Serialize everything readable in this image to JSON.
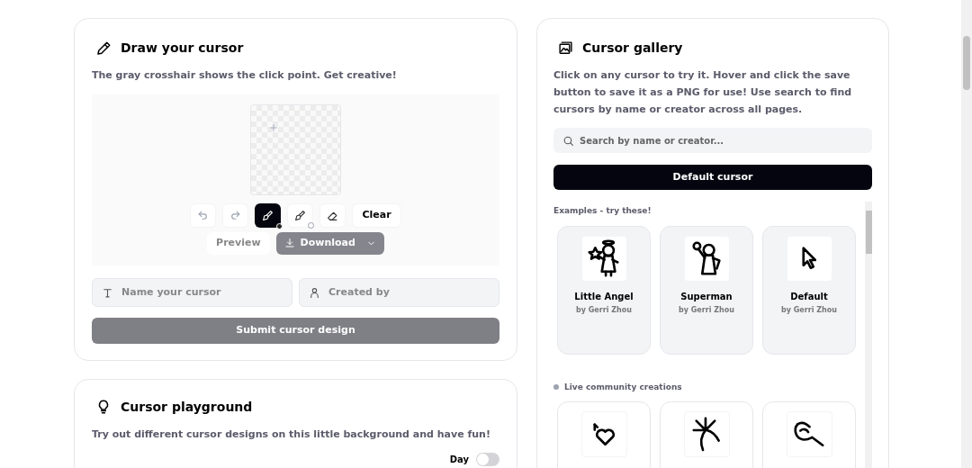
{
  "draw": {
    "title": "Draw your cursor",
    "subtitle": "The gray crosshair shows the click point. Get creative!",
    "tools": [
      {
        "kind": "undo",
        "selected": false
      },
      {
        "kind": "redo",
        "selected": false
      },
      {
        "kind": "brush",
        "selected": true
      },
      {
        "kind": "brush",
        "selected": false
      },
      {
        "kind": "eraser",
        "selected": false
      },
      {
        "kind": "text",
        "label": "Clear",
        "selected": false
      }
    ],
    "preview_button": "Preview",
    "download_button": "Download",
    "name_field": {
      "placeholder": "Name your cursor"
    },
    "creator_field": {
      "placeholder": "Created by"
    },
    "submit_button": "Submit cursor design"
  },
  "playground": {
    "title": "Cursor playground",
    "subtitle": "Try out different cursor designs on this little background and have fun!",
    "toggle": {
      "label": "Day",
      "on": false
    }
  },
  "gallery": {
    "title": "Cursor gallery",
    "description": "Click on any cursor to try it. Hover and click the save button to save it as a PNG for use! Use search to find cursors by name or creator across all pages.",
    "search": {
      "placeholder": "Search by name or creator..."
    },
    "default_button": "Default cursor",
    "examples_heading": "Examples - try these!",
    "examples": [
      {
        "name": "Little Angel",
        "author": "by Gerri Zhou",
        "kind": "angel"
      },
      {
        "name": "Superman",
        "author": "by Gerri Zhou",
        "kind": "hero"
      },
      {
        "name": "Default",
        "author": "by Gerri Zhou",
        "kind": "arrow"
      }
    ],
    "community_heading": "Live community creations",
    "community": [
      {
        "kind": "heart"
      },
      {
        "kind": "sparkle"
      },
      {
        "kind": "hand"
      }
    ]
  }
}
